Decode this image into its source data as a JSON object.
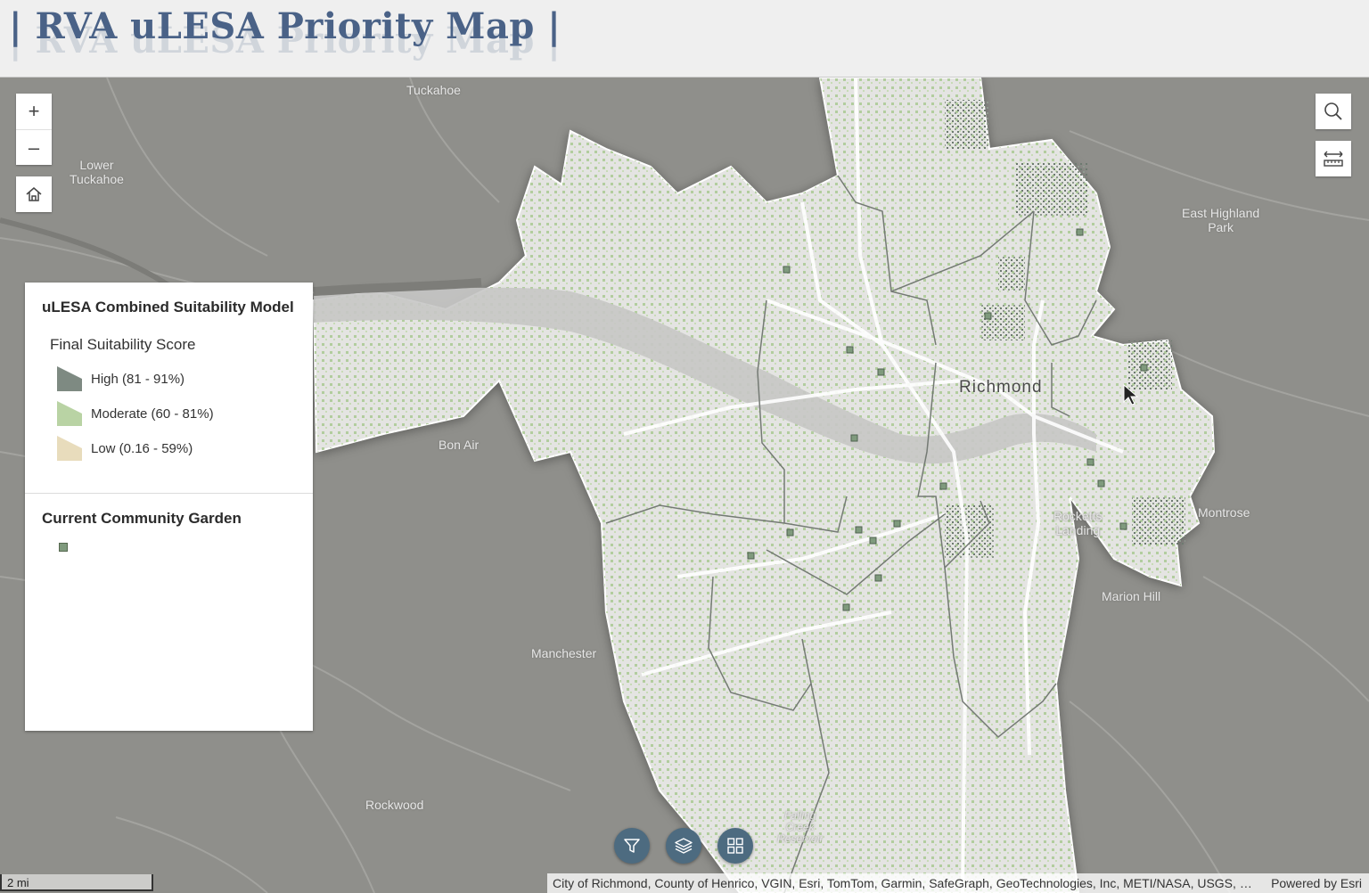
{
  "header": {
    "title": "| RVA uLESA Priority Map |"
  },
  "map": {
    "places": [
      {
        "name": "Tuckahoe"
      },
      {
        "name": "Lower\nTuckahoe"
      },
      {
        "name": "East Highland\nPark"
      },
      {
        "name": "Richmond"
      },
      {
        "name": "Bon Air"
      },
      {
        "name": "Rocketts\nLanding"
      },
      {
        "name": "Montrose"
      },
      {
        "name": "Marion Hill"
      },
      {
        "name": "Manchester"
      },
      {
        "name": "Rockwood"
      },
      {
        "name": "Falling\nCreek\nReservoir"
      }
    ]
  },
  "controls": {
    "zoom_in": "+",
    "zoom_out": "–",
    "home_icon": "home-icon",
    "search_icon": "search-icon",
    "measure_icon": "measure-icon",
    "filter_icon": "filter-icon",
    "layers_icon": "layers-icon",
    "basemap_icon": "grid-icon"
  },
  "legend": {
    "layer_title": "uLESA Combined Suitability Model",
    "field_title": "Final Suitability Score",
    "classes": [
      {
        "label": "High (81 - 91%)",
        "color": "#7e8a82"
      },
      {
        "label": "Moderate (60 - 81%)",
        "color": "#b9d3a4"
      },
      {
        "label": "Low (0.16 - 59%)",
        "color": "#e8dcbc"
      }
    ],
    "layer2_title": "Current Community Garden",
    "garden_color": "#7f9a7d"
  },
  "scale_bar": {
    "label": "2 mi"
  },
  "attribution": {
    "sources": "City of Richmond, County of Henrico, VGIN, Esri, TomTom, Garmin, SafeGraph, GeoTechnologies, Inc, METI/NASA, USGS, Bureau of Land Management, EPA, NPS, USDA",
    "powered_by": "Powered by Esri"
  },
  "colors": {
    "header_bg": "#efefef",
    "title": "#4a6287",
    "basemap": "#8f8f8b",
    "city": "#e4e4e2",
    "suitability_moderate": "#a9c992",
    "fab": "#4d6b80"
  }
}
